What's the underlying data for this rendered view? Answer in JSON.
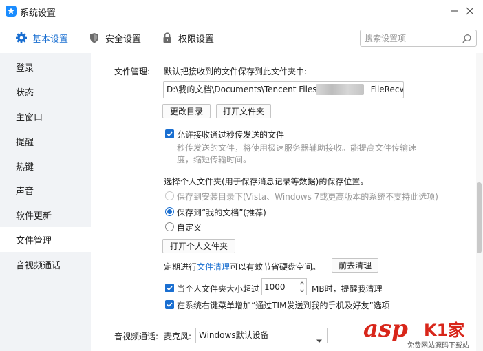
{
  "window": {
    "title": "系统设置"
  },
  "top_tabs": [
    {
      "label": "基本设置",
      "icon": "gear-icon",
      "active": true
    },
    {
      "label": "安全设置",
      "icon": "shield-icon",
      "active": false
    },
    {
      "label": "权限设置",
      "icon": "lock-icon",
      "active": false
    }
  ],
  "search": {
    "placeholder": "搜索设置项"
  },
  "sidebar": {
    "items": [
      {
        "label": "登录"
      },
      {
        "label": "状态"
      },
      {
        "label": "主窗口"
      },
      {
        "label": "提醒"
      },
      {
        "label": "热键"
      },
      {
        "label": "声音"
      },
      {
        "label": "软件更新"
      },
      {
        "label": "文件管理",
        "active": true
      },
      {
        "label": "音视频通话"
      }
    ]
  },
  "file_mgmt": {
    "section_label": "文件管理:",
    "save_desc": "默认把接收到的文件保存到此文件夹中:",
    "path_prefix": "D:\\我的文档\\Documents\\Tencent Files\\",
    "path_suffix": "FileRecv\\",
    "change_dir_btn": "更改目录",
    "open_folder_btn": "打开文件夹",
    "allow_instant_label": "允许接收通过秒传发送的文件",
    "allow_instant_desc_1": "秒传发送的文件，将使用极速服务器辅助接收。能提高文件传输速",
    "allow_instant_desc_2": "度，缩短传输时间。",
    "personal_folder_title": "选择个人文件夹(用于保存消息记录等数据)的保存位置。",
    "radio_install_dir": "保存到安装目录下(Vista、Windows 7或更高版本的系统不支持此选项)",
    "radio_my_docs": "保存到“我的文档”(推荐)",
    "radio_custom": "自定义",
    "open_personal_btn": "打开个人文件夹",
    "cleanup_prefix": "定期进行",
    "cleanup_link": "文件清理",
    "cleanup_suffix": "可以有效节省硬盘空间。",
    "go_clean_btn": "前去清理",
    "size_exceed_label": "当个人文件夹大小超过",
    "size_value": "1000",
    "size_unit_suffix": "MB时，提醒我清理",
    "context_menu_label": "在系统右键菜单增加“通过TIM发送到我的手机及好友”选项"
  },
  "av_call": {
    "section_label": "音视频通话:",
    "mic_label": "麦克风:",
    "mic_device": "Windows默认设备"
  },
  "watermark": {
    "brand": "asp",
    "brand_cn": "K1家",
    "sub": "免费网站源码下载站"
  },
  "colors": {
    "accent": "#1a6fd1",
    "sidebar_bg": "#f1f3f6",
    "watermark_red": "#d8261a"
  }
}
